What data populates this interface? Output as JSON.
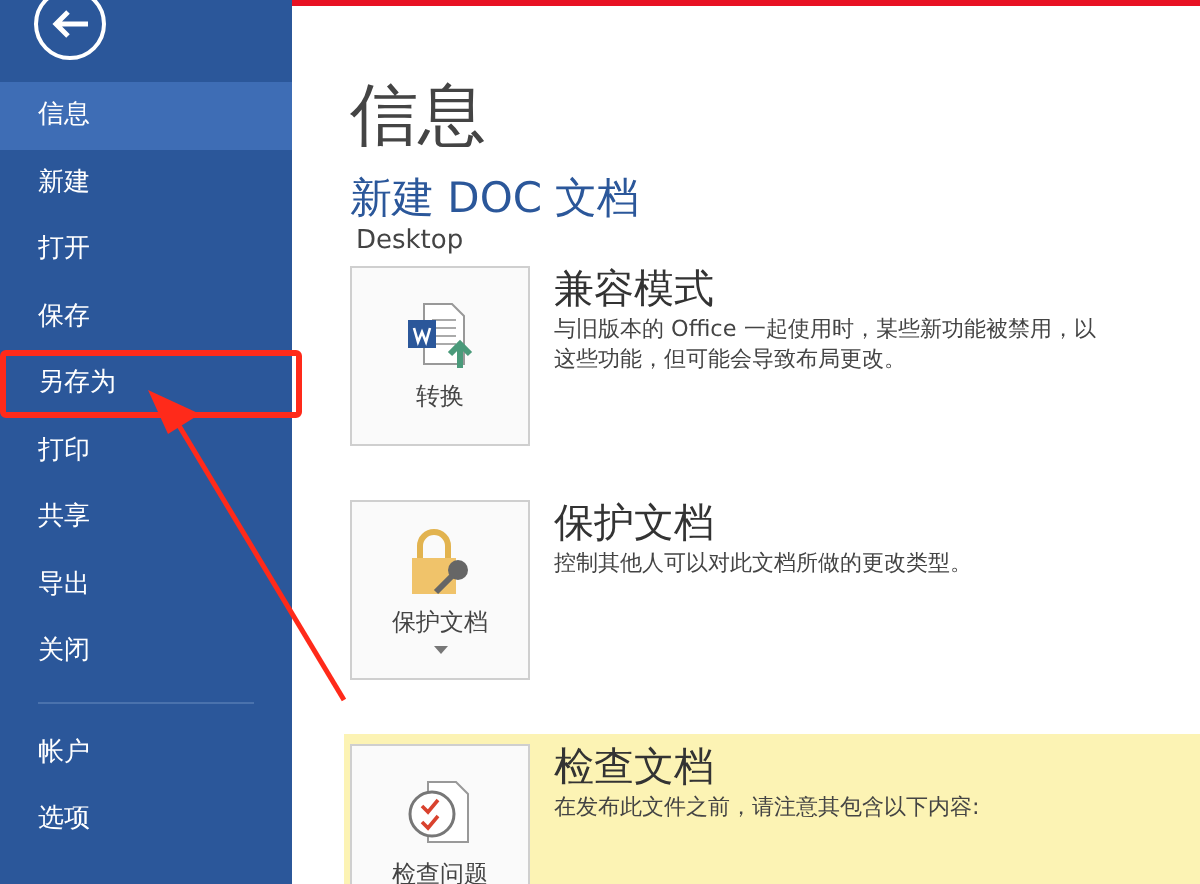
{
  "sidebar": {
    "items": [
      {
        "label": "信息",
        "selected": true,
        "annotated": false
      },
      {
        "label": "新建",
        "selected": false,
        "annotated": false
      },
      {
        "label": "打开",
        "selected": false,
        "annotated": false
      },
      {
        "label": "保存",
        "selected": false,
        "annotated": false
      },
      {
        "label": "另存为",
        "selected": false,
        "annotated": true
      },
      {
        "label": "打印",
        "selected": false,
        "annotated": false
      },
      {
        "label": "共享",
        "selected": false,
        "annotated": false
      },
      {
        "label": "导出",
        "selected": false,
        "annotated": false
      },
      {
        "label": "关闭",
        "selected": false,
        "annotated": false
      }
    ],
    "bottom_items": [
      {
        "label": "帐户",
        "selected": false
      },
      {
        "label": "选项",
        "selected": false
      }
    ]
  },
  "page_title": "信息",
  "document_name": "新建 DOC 文档",
  "document_location": "Desktop",
  "sections": [
    {
      "kind": "convert",
      "title": "兼容模式",
      "description": [
        "与旧版本的 Office 一起使用时，某些新功能被禁用，以",
        "这些功能，但可能会导致布局更改。"
      ],
      "button": {
        "label": "转换",
        "dropdown": false
      },
      "highlighted": false
    },
    {
      "kind": "protect",
      "title": "保护文档",
      "description": [
        "控制其他人可以对此文档所做的更改类型。"
      ],
      "button": {
        "label": "保护文档",
        "dropdown": true
      },
      "highlighted": false
    },
    {
      "kind": "inspect",
      "title": "检查文档",
      "description": [
        "在发布此文件之前，请注意其包含以下内容:"
      ],
      "button": {
        "label": "检查问题",
        "dropdown": false
      },
      "highlighted": true
    }
  ]
}
